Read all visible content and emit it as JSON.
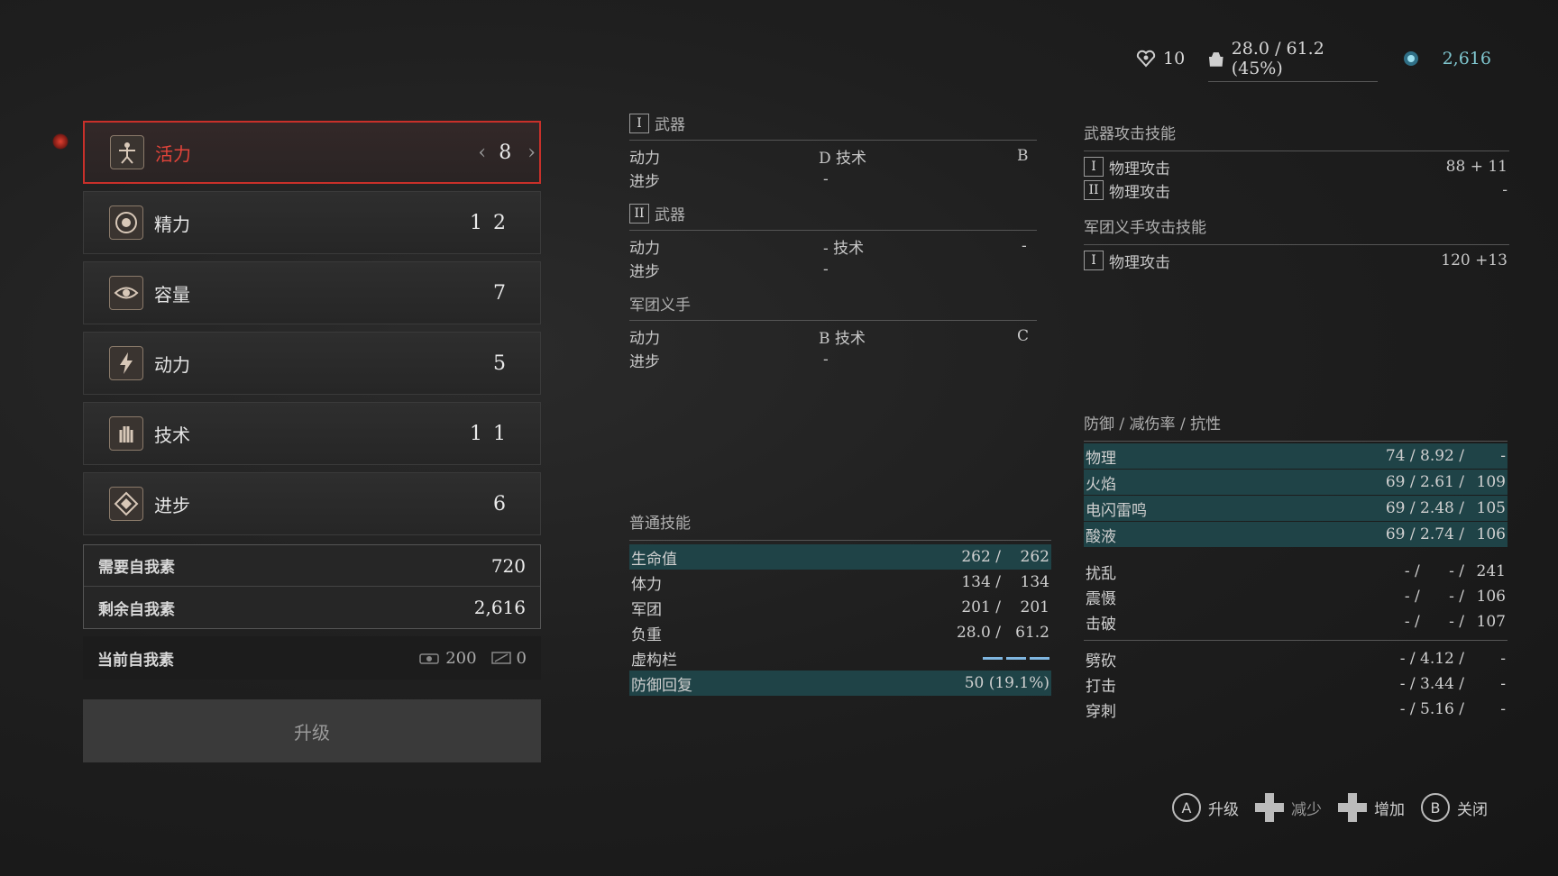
{
  "topbar": {
    "items_count": "10",
    "weight": "28.0 / 61.2 (45%)",
    "souls": "2,616"
  },
  "attributes": [
    {
      "label": "活力",
      "value": "8",
      "selected": true,
      "icon": "vitruvian-man-icon"
    },
    {
      "label": "精力",
      "value": "12",
      "icon": "target-icon"
    },
    {
      "label": "容量",
      "value": "7",
      "icon": "eye-icon"
    },
    {
      "label": "动力",
      "value": "5",
      "icon": "lightning-icon"
    },
    {
      "label": "技术",
      "value": "11",
      "icon": "hand-icon"
    },
    {
      "label": "进步",
      "value": "6",
      "icon": "diamond-icon"
    }
  ],
  "costs": {
    "need_label": "需要自我素",
    "need_value": "720",
    "remain_label": "剩余自我素",
    "remain_value": "2,616",
    "current_label": "当前自我素",
    "current_a": "200",
    "current_b": "0"
  },
  "upgrade_label": "升级",
  "weapons": {
    "w1": {
      "roman": "I",
      "title": "武器",
      "r1_a": "动力",
      "r1_b": "D 技术",
      "r1_c": "B",
      "r2_a": "进步",
      "r2_b": "-"
    },
    "w2": {
      "roman": "II",
      "title": "武器",
      "r1_a": "动力",
      "r1_b": "- 技术",
      "r1_c": "-",
      "r2_a": "进步",
      "r2_b": "-"
    },
    "legion": {
      "title": "军团义手",
      "r1_a": "动力",
      "r1_b": "B 技术",
      "r1_c": "C",
      "r2_a": "进步",
      "r2_b": "-"
    }
  },
  "basic": {
    "title": "普通技能",
    "rows": [
      {
        "label": "生命值",
        "value": "262 /    262"
      },
      {
        "label": "体力",
        "value": "134 /    134"
      },
      {
        "label": "军团",
        "value": "201 /    201"
      },
      {
        "label": "负重",
        "value": "28.0 /   61.2"
      },
      {
        "label": "虚构栏",
        "value": ""
      },
      {
        "label": "防御回复",
        "value": "50 (19.1%)"
      }
    ]
  },
  "attack": {
    "title": "武器攻击技能",
    "r1_roman": "I",
    "r1_label": "物理攻击",
    "r1_value": "88 + 11",
    "r2_roman": "II",
    "r2_label": "物理攻击",
    "r2_value": "-",
    "legion_title": "军团义手攻击技能",
    "r3_roman": "I",
    "r3_label": "物理攻击",
    "r3_value": "120 +13"
  },
  "defense": {
    "title": "防御 / 减伤率 / 抗性",
    "hl_rows": [
      {
        "label": "物理",
        "a": "74 / 8.92 /",
        "b": "-"
      },
      {
        "label": "火焰",
        "a": "69 / 2.61 /",
        "b": "109"
      },
      {
        "label": "电闪雷鸣",
        "a": "69 / 2.48 /",
        "b": "105"
      },
      {
        "label": "酸液",
        "a": "69 / 2.74 /",
        "b": "106"
      }
    ],
    "rows": [
      {
        "label": "扰乱",
        "a": "- /      - /",
        "b": "241"
      },
      {
        "label": "震慑",
        "a": "- /      - /",
        "b": "106"
      },
      {
        "label": "击破",
        "a": "- /      - /",
        "b": "107"
      }
    ],
    "rows2": [
      {
        "label": "劈砍",
        "a": "- / 4.12 /",
        "b": "-"
      },
      {
        "label": "打击",
        "a": "- / 3.44 /",
        "b": "-"
      },
      {
        "label": "穿刺",
        "a": "- / 5.16 /",
        "b": "-"
      }
    ]
  },
  "legend": {
    "a_key": "A",
    "a_label": "升级",
    "dec_label": "减少",
    "inc_label": "增加",
    "b_key": "B",
    "b_label": "关闭"
  },
  "colors": {
    "accent_red": "#c8302a",
    "highlight_teal": "#1f4347",
    "souls_cyan": "#7fc6cf"
  }
}
